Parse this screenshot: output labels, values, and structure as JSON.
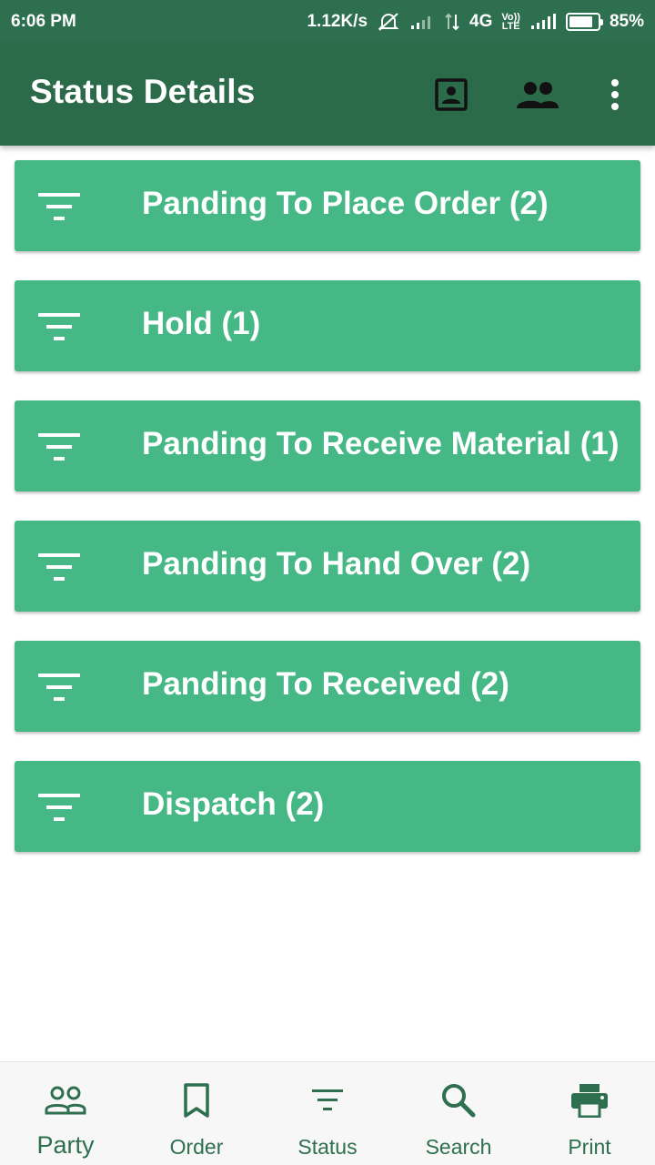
{
  "status_bar": {
    "time": "6:06 PM",
    "net_speed": "1.12K/s",
    "network_type": "4G",
    "volte_top": "Vo))",
    "volte_bottom": "LTE",
    "battery_percent": "85%",
    "battery_level": 0.85
  },
  "app_bar": {
    "title": "Status Details",
    "icons": [
      "contact-card-icon",
      "people-icon",
      "more-vert-icon"
    ]
  },
  "status_list": [
    {
      "label": "Panding To Place Order  (2)",
      "icon": "filter-icon"
    },
    {
      "label": "Hold (1)",
      "icon": "filter-icon"
    },
    {
      "label": "Panding To Receive Material  (1)",
      "icon": "filter-icon"
    },
    {
      "label": "Panding To Hand Over  (2)",
      "icon": "filter-icon"
    },
    {
      "label": "Panding To Received  (2)",
      "icon": "filter-icon"
    },
    {
      "label": "Dispatch  (2)",
      "icon": "filter-icon"
    }
  ],
  "bottom_nav": [
    {
      "label": "Party",
      "icon": "party-icon",
      "active": true
    },
    {
      "label": "Order",
      "icon": "bookmark-icon",
      "active": false
    },
    {
      "label": "Status",
      "icon": "filter-icon",
      "active": false
    },
    {
      "label": "Search",
      "icon": "search-icon",
      "active": false
    },
    {
      "label": "Print",
      "icon": "print-icon",
      "active": false
    }
  ],
  "colors": {
    "primary": "#2c6b4a",
    "status_bar": "#2e6f4f",
    "card": "#45b885",
    "nav_background": "#f7f7f7",
    "nav_text": "#2e6f4f"
  }
}
